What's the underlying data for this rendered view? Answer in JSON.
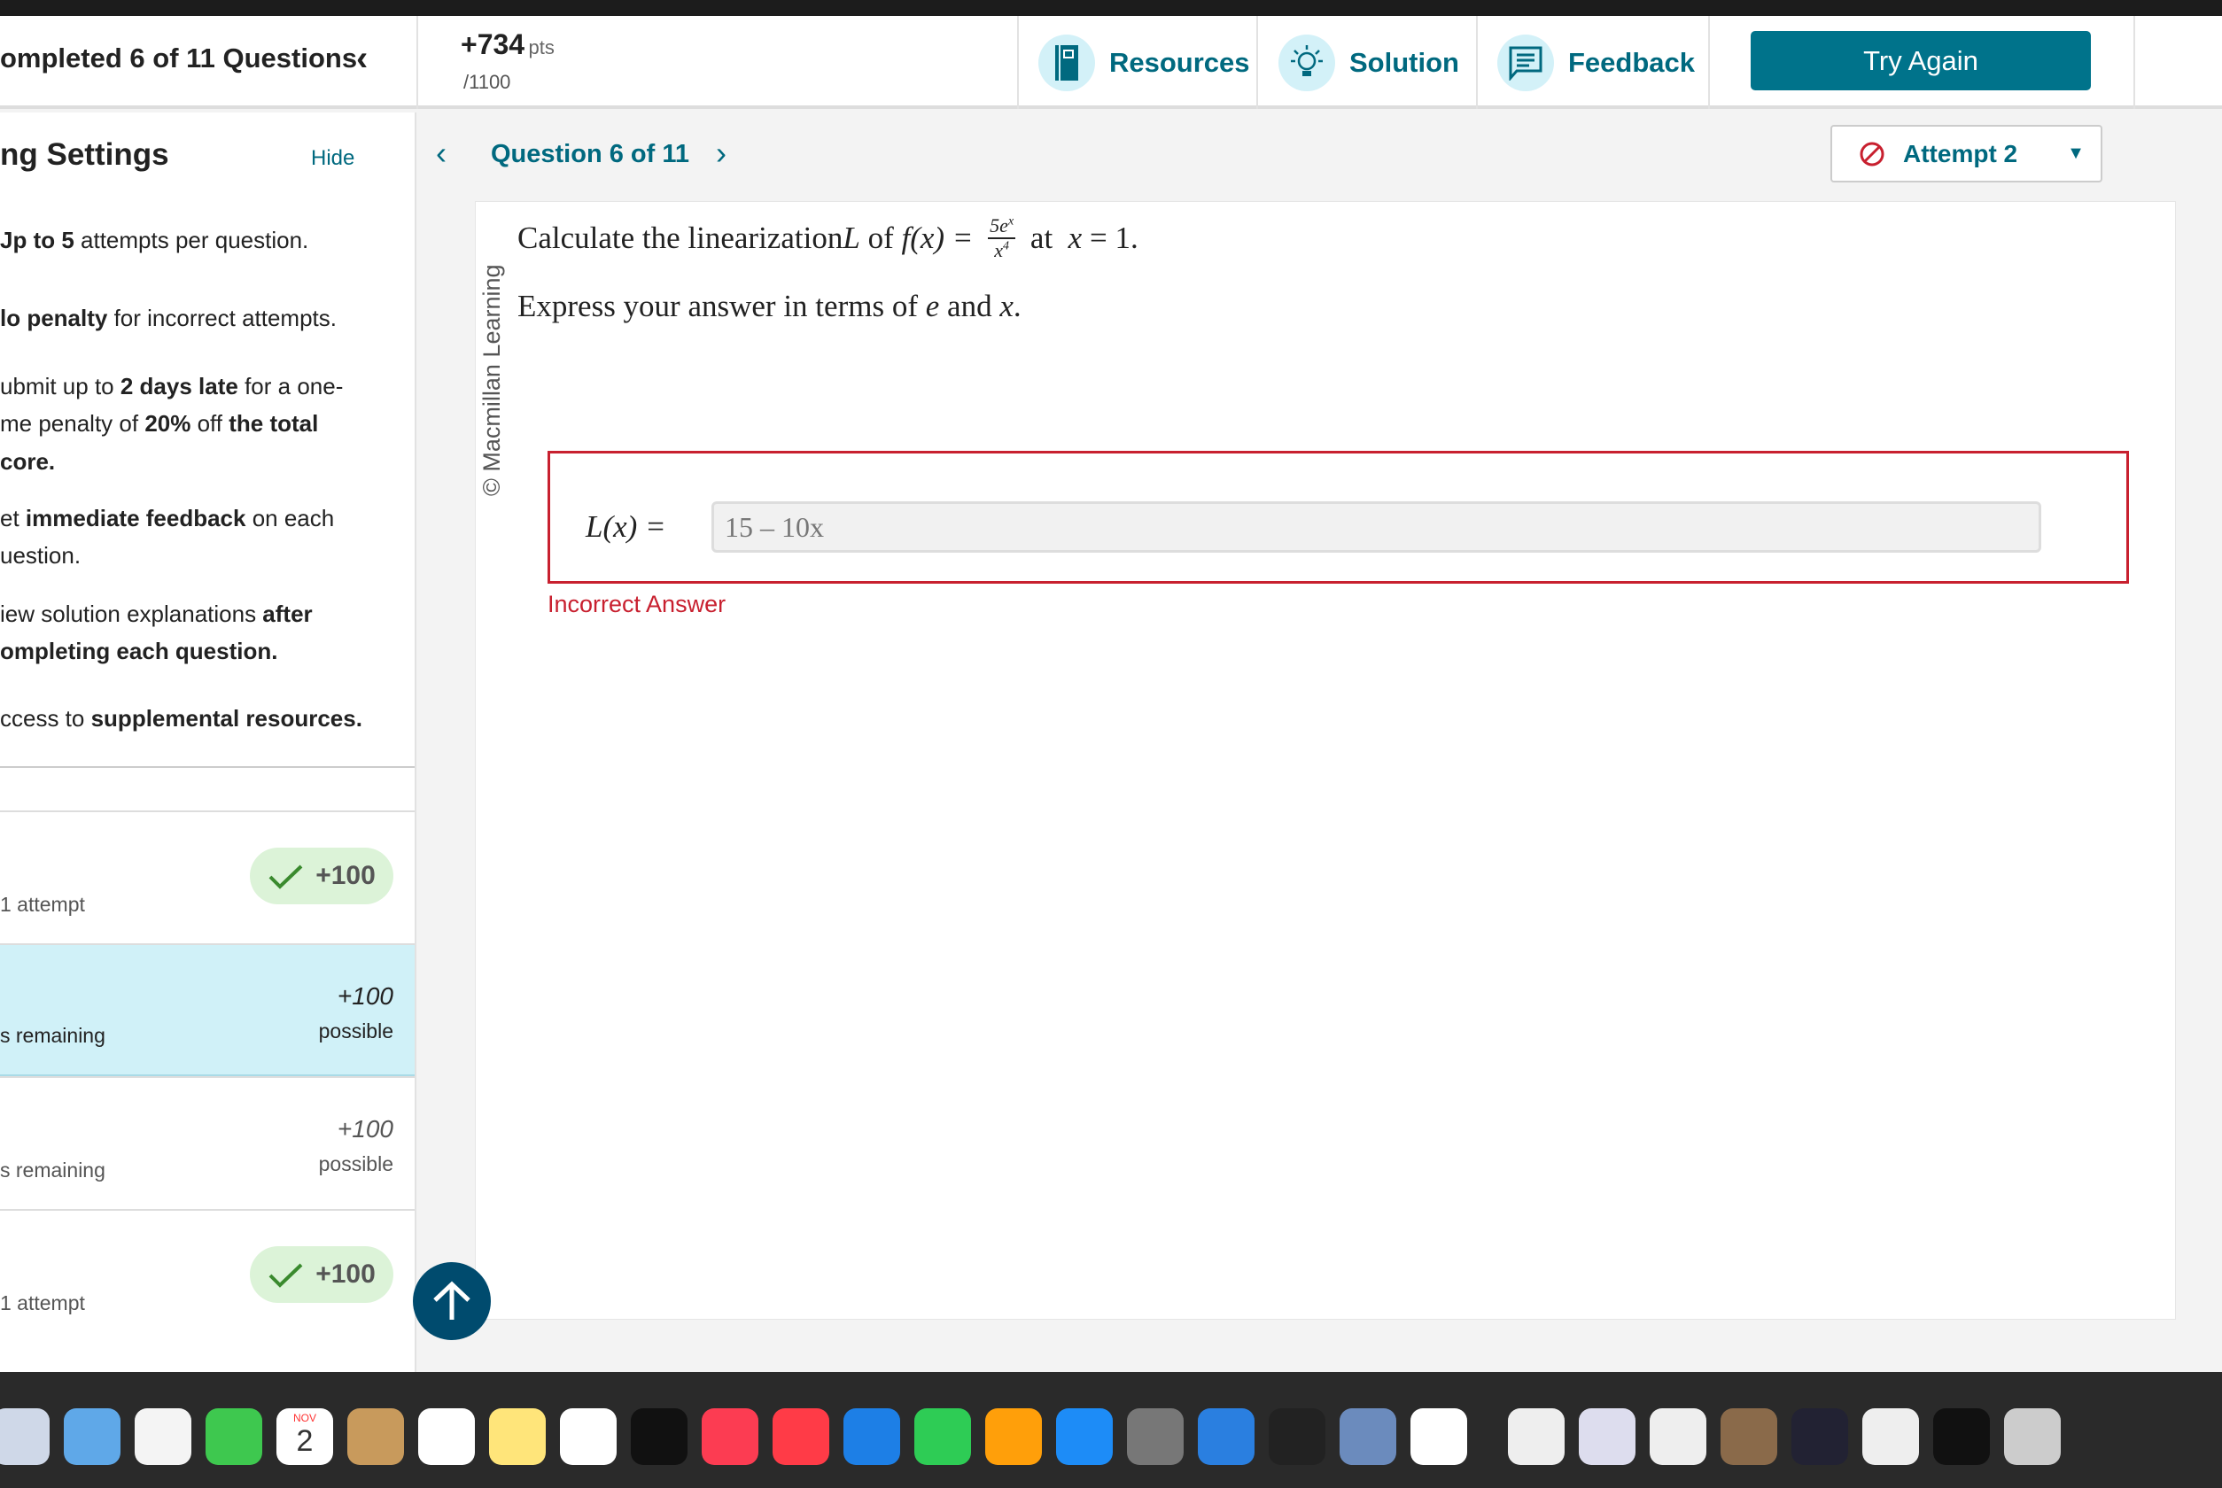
{
  "header": {
    "progress": "ompleted 6 of 11 Questions",
    "points": "+734",
    "points_unit": "pts",
    "points_total": "/1100",
    "tools": [
      {
        "label": "Resources",
        "icon": "book-icon"
      },
      {
        "label": "Solution",
        "icon": "lightbulb-icon"
      },
      {
        "label": "Feedback",
        "icon": "speech-bubble-icon"
      }
    ],
    "try_again": "Try Again"
  },
  "sidebar": {
    "title": "ng Settings",
    "hide": "Hide",
    "settings": [
      {
        "parts": [
          {
            "b": true,
            "t": "Jp to 5"
          },
          {
            "t": " attempts per question."
          }
        ]
      },
      {
        "parts": [
          {
            "b": true,
            "t": "lo penalty"
          },
          {
            "t": " for incorrect attempts."
          }
        ]
      },
      {
        "parts": [
          {
            "t": "ubmit up to "
          },
          {
            "b": true,
            "t": "2 days late"
          },
          {
            "t": " for a one-"
          }
        ]
      },
      {
        "parts": [
          {
            "t": "me penalty of "
          },
          {
            "b": true,
            "t": "20%"
          },
          {
            "t": " off "
          },
          {
            "b": true,
            "t": "the total"
          }
        ]
      },
      {
        "parts": [
          {
            "b": true,
            "t": "core."
          }
        ]
      },
      {
        "parts": [
          {
            "t": "et "
          },
          {
            "b": true,
            "t": "immediate feedback"
          },
          {
            "t": " on each"
          }
        ]
      },
      {
        "parts": [
          {
            "t": "uestion."
          }
        ]
      },
      {
        "parts": [
          {
            "t": "iew solution explanations "
          },
          {
            "b": true,
            "t": "after"
          }
        ]
      },
      {
        "parts": [
          {
            "b": true,
            "t": "ompleting each question."
          }
        ]
      },
      {
        "parts": [
          {
            "t": "ccess to "
          },
          {
            "b": true,
            "t": "supplemental resources."
          }
        ]
      }
    ],
    "rows": [
      {
        "label": "1 attempt",
        "badge": "+100",
        "correct": true
      },
      {
        "label": "s remaining",
        "points": "+100",
        "possible": "possible",
        "active": true
      },
      {
        "label": "s remaining",
        "points": "+100",
        "possible": "possible"
      },
      {
        "label": "1 attempt",
        "badge": "+100",
        "correct": true
      }
    ]
  },
  "question": {
    "nav_label": "Question 6 of 11",
    "attempt": "Attempt 2",
    "watermark": "© Macmillan Learning",
    "prompt_pre": "Calculate the linearization ",
    "L": "L",
    "of": " of ",
    "fx": "f",
    "paren_x": "(x) = ",
    "num": "5e",
    "num_sup": "x",
    "den": "x",
    "den_sup": "4",
    "at": " at ",
    "x_eq": "x",
    "eq1": " = 1.",
    "line2_pre": "Express your answer in terms of ",
    "e": "e",
    "and": " and ",
    "x": "x",
    "dot": ".",
    "answer_label": "L(x) =",
    "answer_value": "15 – 10x",
    "feedback": "Incorrect Answer"
  },
  "colors": {
    "accent": "#00697f",
    "error": "#c8202f",
    "correct": "#3a8a2e",
    "active_row": "#d0f1f8"
  },
  "dock": [
    "finder-icon",
    "maps-icon",
    "photos-icon",
    "facetime-icon",
    "calendar-icon",
    "contacts-icon",
    "reminders-icon",
    "notes-icon",
    "freeform-icon",
    "tv-icon",
    "music-icon",
    "news-icon",
    "keynote-icon",
    "numbers-icon",
    "pages-icon",
    "app-store-icon",
    "system-settings-icon",
    "quicktime-icon",
    "piano-icon",
    "preview-icon",
    "chrome-icon",
    "document-icon",
    "window-thumbnail-icon",
    "window-thumbnail-icon",
    "window-thumbnail-icon",
    "window-thumbnail-icon",
    "window-thumbnail-icon",
    "window-thumbnail-icon",
    "trash-icon"
  ],
  "calendar": {
    "month": "NOV",
    "day": "2"
  }
}
